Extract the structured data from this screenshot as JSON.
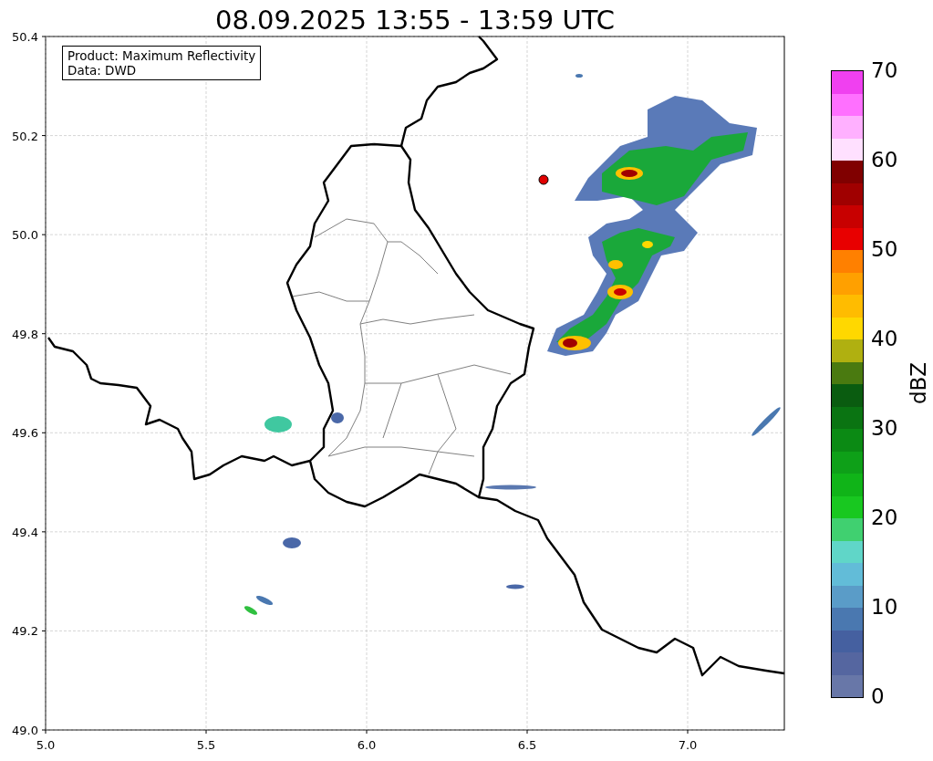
{
  "title": "08.09.2025 13:55 - 13:59 UTC",
  "legend": {
    "lines": [
      "Product: Maximum Reflectivity",
      "Data: DWD"
    ]
  },
  "x_axis": {
    "ticks": [
      "5.0",
      "5.5",
      "6.0",
      "6.5",
      "7.0"
    ]
  },
  "y_axis": {
    "ticks": [
      "50.4",
      "50.2",
      "50.0",
      "49.8",
      "49.6",
      "49.4",
      "49.2",
      "49.0"
    ]
  },
  "colorbar": {
    "label": "dBZ",
    "ticks": [
      "70",
      "60",
      "50",
      "40",
      "30",
      "20",
      "10",
      "0"
    ],
    "segments": [
      {
        "color": "#6877a8"
      },
      {
        "color": "#5566a0"
      },
      {
        "color": "#4560a0"
      },
      {
        "color": "#4a78b0"
      },
      {
        "color": "#5a9cc8"
      },
      {
        "color": "#62bcd8"
      },
      {
        "color": "#60d6c8"
      },
      {
        "color": "#40d070"
      },
      {
        "color": "#18c820"
      },
      {
        "color": "#10b418"
      },
      {
        "color": "#0ea018"
      },
      {
        "color": "#0b8a14"
      },
      {
        "color": "#0a7412"
      },
      {
        "color": "#0a5c10"
      },
      {
        "color": "#4a7a10"
      },
      {
        "color": "#b0b010"
      },
      {
        "color": "#ffd800"
      },
      {
        "color": "#ffbc00"
      },
      {
        "color": "#ffa000"
      },
      {
        "color": "#ff8000"
      },
      {
        "color": "#e80000"
      },
      {
        "color": "#c80000"
      },
      {
        "color": "#a00000"
      },
      {
        "color": "#800000"
      },
      {
        "color": "#ffe0ff"
      },
      {
        "color": "#ffb0ff"
      },
      {
        "color": "#ff70ff"
      },
      {
        "color": "#f040f0"
      }
    ]
  }
}
